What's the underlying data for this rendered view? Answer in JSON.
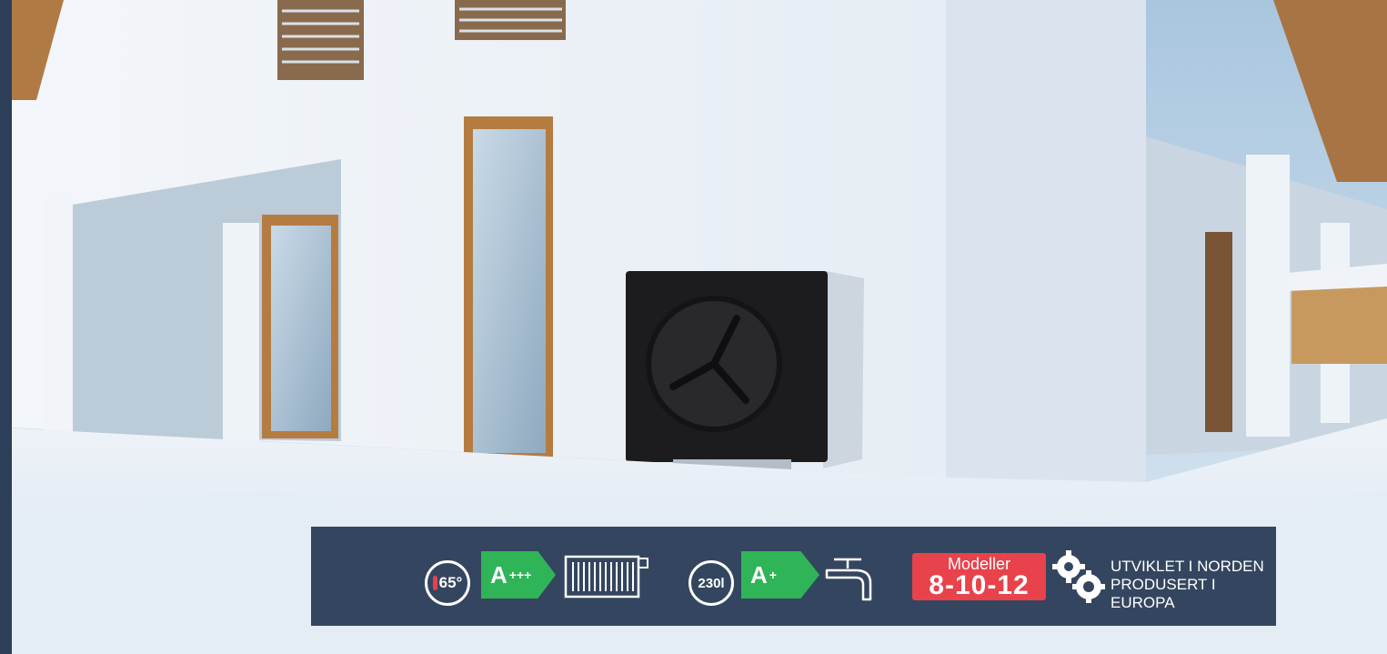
{
  "photo": {
    "subject": "heat-pump-outdoor-unit",
    "colors": {
      "sky": "#b9d4ea",
      "wall": "#f4f7fb",
      "snow": "#e9f0f7",
      "unit": "#1c1c1f",
      "bar": "#34465f",
      "green": "#2fb458",
      "red": "#e8424b"
    }
  },
  "infobar": {
    "heating": {
      "temperature": "65°",
      "energy_class": "A",
      "energy_plus": "+++",
      "emitter_icon": "radiator-icon"
    },
    "hot_water": {
      "tank_volume": "230l",
      "energy_class": "A",
      "energy_plus": "+",
      "outlet_icon": "tap-icon"
    },
    "models": {
      "label": "Modeller",
      "numbers": "8-10-12"
    },
    "origin": {
      "icon": "gears-icon",
      "line1": "UTVIKLET I NORDEN",
      "line2": "PRODUSERT I EUROPA"
    }
  }
}
